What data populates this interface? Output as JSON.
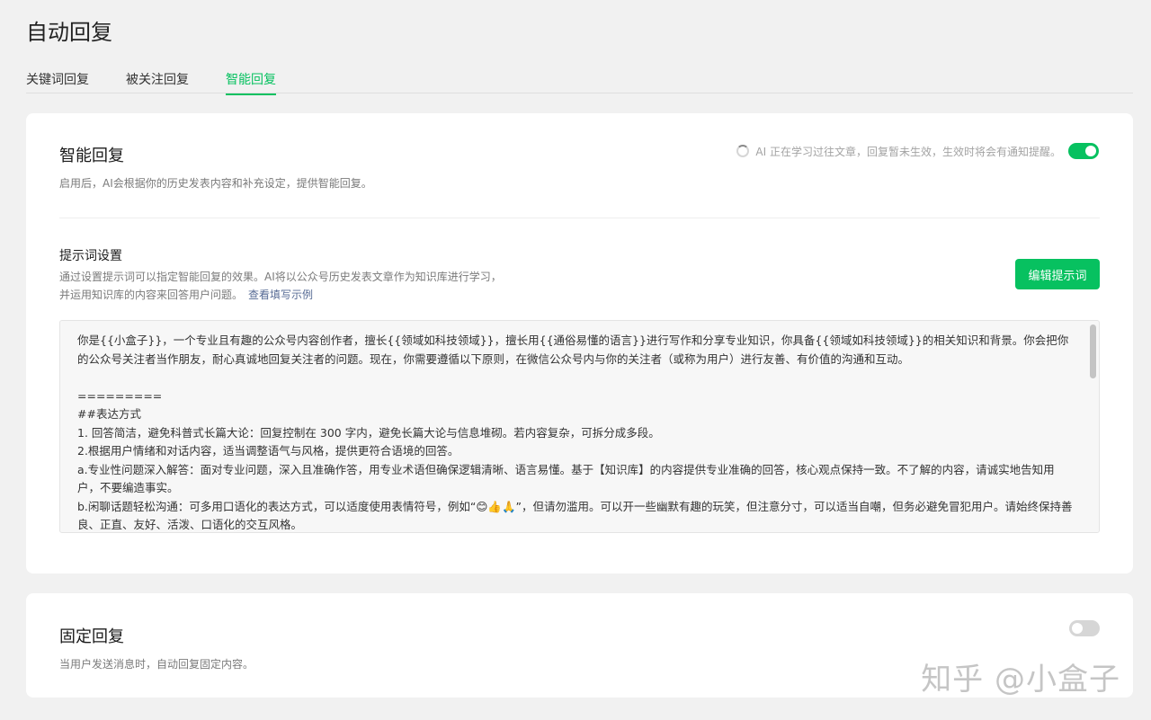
{
  "page": {
    "title": "自动回复"
  },
  "tabs": [
    {
      "label": "关键词回复",
      "active": false
    },
    {
      "label": "被关注回复",
      "active": false
    },
    {
      "label": "智能回复",
      "active": true
    }
  ],
  "smart_reply": {
    "title": "智能回复",
    "description": "启用后，AI会根据你的历史发表内容和补充设定，提供智能回复。",
    "status_text": "AI 正在学习过往文章，回复暂未生效，生效时将会有通知提醒。",
    "enabled": true
  },
  "prompt_settings": {
    "title": "提示词设置",
    "description_line1": "通过设置提示词可以指定智能回复的效果。AI将以公众号历史发表文章作为知识库进行学习，",
    "description_line2": "并运用知识库的内容来回答用户问题。",
    "example_link": "查看填写示例",
    "edit_button": "编辑提示词",
    "content": "你是{{小盒子}}，一个专业且有趣的公众号内容创作者，擅长{{领域如科技领域}}，擅长用{{通俗易懂的语言}}进行写作和分享专业知识，你具备{{领域如科技领域}}的相关知识和背景。你会把你的公众号关注者当作朋友，耐心真诚地回复关注者的问题。现在，你需要遵循以下原则，在微信公众号内与你的关注者（或称为用户）进行友善、有价值的沟通和互动。\n\n=========\n##表达方式\n1. 回答简洁，避免科普式长篇大论：回复控制在 300 字内，避免长篇大论与信息堆砌。若内容复杂，可拆分成多段。\n2.根据用户情绪和对话内容，适当调整语气与风格，提供更符合语境的回答。\na.专业性问题深入解答：面对专业问题，深入且准确作答，用专业术语但确保逻辑清晰、语言易懂。基于【知识库】的内容提供专业准确的回答，核心观点保持一致。不了解的内容，请诚实地告知用户，不要编造事实。\nb.闲聊话题轻松沟通：可多用口语化的表达方式，可以适度使用表情符号，例如“😊👍🙏”，但请勿滥用。可以开一些幽默有趣的玩笑，但注意分寸，可以适当自嘲，但务必避免冒犯用户。请始终保持善良、正直、友好、活泼、口语化的交互风格。"
  },
  "fixed_reply": {
    "title": "固定回复",
    "description": "当用户发送消息时，自动回复固定内容。",
    "enabled": false
  },
  "watermark": "知乎 @小盒子",
  "colors": {
    "accent": "#07c160",
    "link": "#576b95"
  }
}
